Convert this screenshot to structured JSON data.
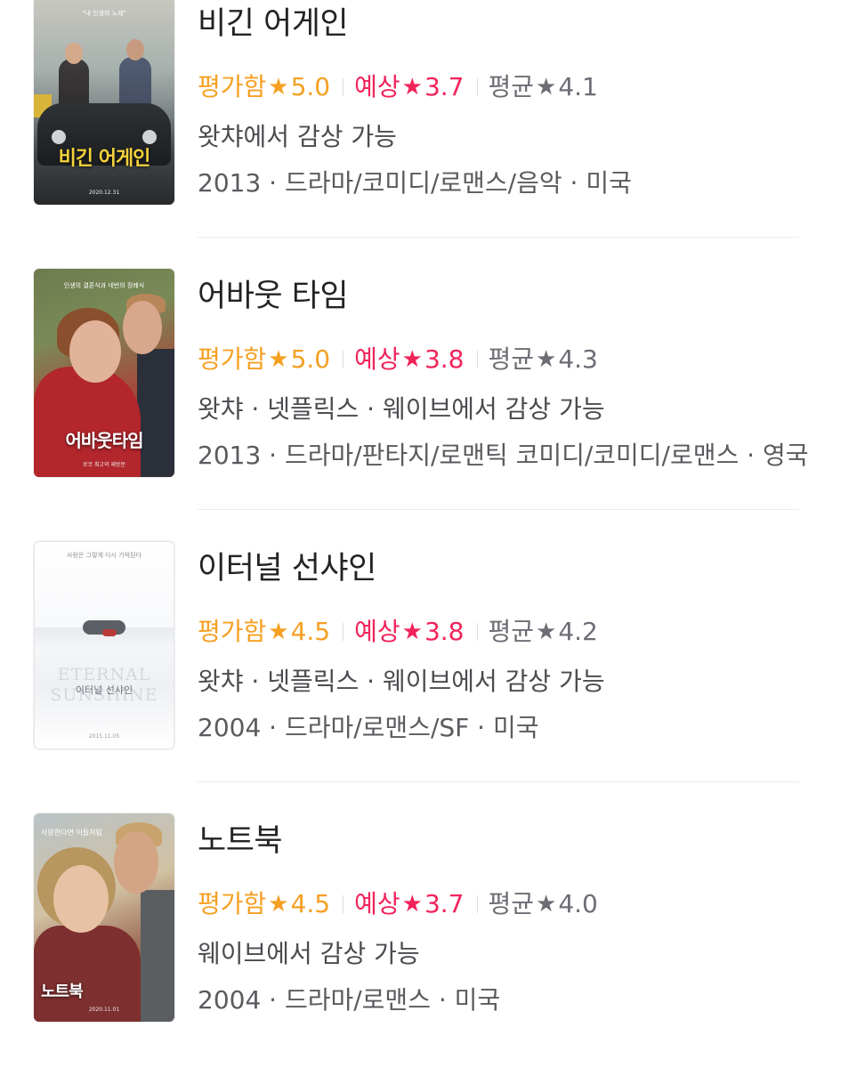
{
  "movies": [
    {
      "title": "비긴 어게인",
      "poster_title": "비긴 어게인",
      "poster_tagline": "\"내 인생의 노래\"",
      "poster_bottom": "2020.12.31",
      "rating_mine_label": "평가함",
      "rating_mine": "5.0",
      "rating_pred_label": "예상",
      "rating_pred": "3.7",
      "rating_avg_label": "평균",
      "rating_avg": "4.1",
      "streaming": "왓챠에서 감상 가능",
      "meta": "2013 · 드라마/코미디/로맨스/음악 · 미국"
    },
    {
      "title": "어바웃 타임",
      "poster_title": "어바웃타임",
      "poster_tagline": "인생의 결혼식과 네번의 장례식",
      "poster_bottom": "로코 최고의 재방문",
      "rating_mine_label": "평가함",
      "rating_mine": "5.0",
      "rating_pred_label": "예상",
      "rating_pred": "3.8",
      "rating_avg_label": "평균",
      "rating_avg": "4.3",
      "streaming": "왓챠 · 넷플릭스 · 웨이브에서 감상 가능",
      "meta": "2013 · 드라마/판타지/로맨틱 코미디/코미디/로맨스 · 영국"
    },
    {
      "title": "이터널 선샤인",
      "poster_title_en": "ETERNAL SUNSHINE",
      "poster_title": "이터널 선샤인",
      "poster_tagline": "사랑은 그렇게 다시 기억된다",
      "poster_bottom": "2015.11.05",
      "rating_mine_label": "평가함",
      "rating_mine": "4.5",
      "rating_pred_label": "예상",
      "rating_pred": "3.8",
      "rating_avg_label": "평균",
      "rating_avg": "4.2",
      "streaming": "왓챠 · 넷플릭스 · 웨이브에서 감상 가능",
      "meta": "2004 · 드라마/로맨스/SF · 미국"
    },
    {
      "title": "노트북",
      "poster_title": "노트북",
      "poster_tagline": "사랑한다면 이들처럼",
      "poster_bottom": "2020.11.01",
      "rating_mine_label": "평가함",
      "rating_mine": "4.5",
      "rating_pred_label": "예상",
      "rating_pred": "3.7",
      "rating_avg_label": "평균",
      "rating_avg": "4.0",
      "streaming": "웨이브에서 감상 가능",
      "meta": "2004 · 드라마/로맨스 · 미국"
    }
  ],
  "star_glyph": "★",
  "colors": {
    "rating_mine": "#f5a023",
    "rating_pred": "#f2235a",
    "rating_avg": "#6d6d75"
  },
  "icons": {
    "star": "star-icon"
  }
}
